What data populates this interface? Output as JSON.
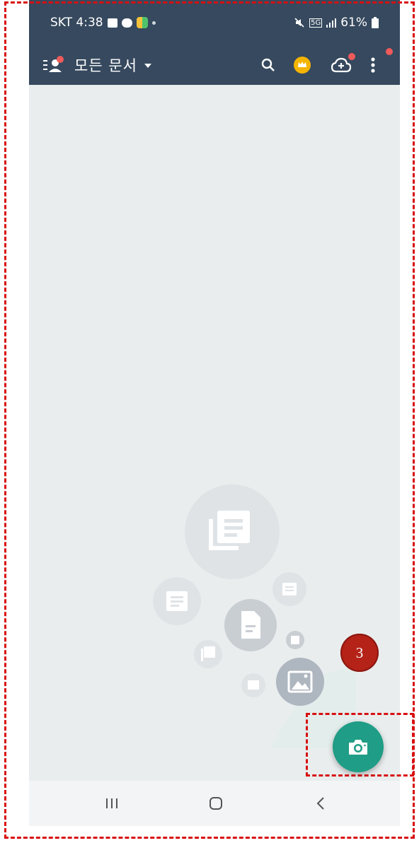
{
  "status_bar": {
    "carrier_time": "SKT 4:38",
    "network": "5G",
    "battery": "61%",
    "icons": [
      "gallery-icon",
      "chat-icon",
      "app-icon",
      "mute-icon",
      "signal-icon",
      "battery-icon"
    ]
  },
  "app_bar": {
    "title": "모든 문서",
    "icons": [
      "menu-profile-icon",
      "search-icon",
      "crown-icon",
      "cloud-upload-icon",
      "more-vert-icon"
    ]
  },
  "empty_state": {
    "icons": [
      "documents-stack-icon",
      "document-icon",
      "file-icon",
      "image-icon"
    ]
  },
  "annotation": {
    "step_number": "3"
  },
  "fab": {
    "icon": "camera-icon"
  },
  "nav_bar": {
    "icons": [
      "recent-apps-icon",
      "home-icon",
      "back-icon"
    ]
  },
  "colors": {
    "app_bar": "#36495e",
    "background": "#e9edee",
    "fab": "#1f9d86",
    "badge": "#b42218",
    "highlight": "#d81010"
  }
}
